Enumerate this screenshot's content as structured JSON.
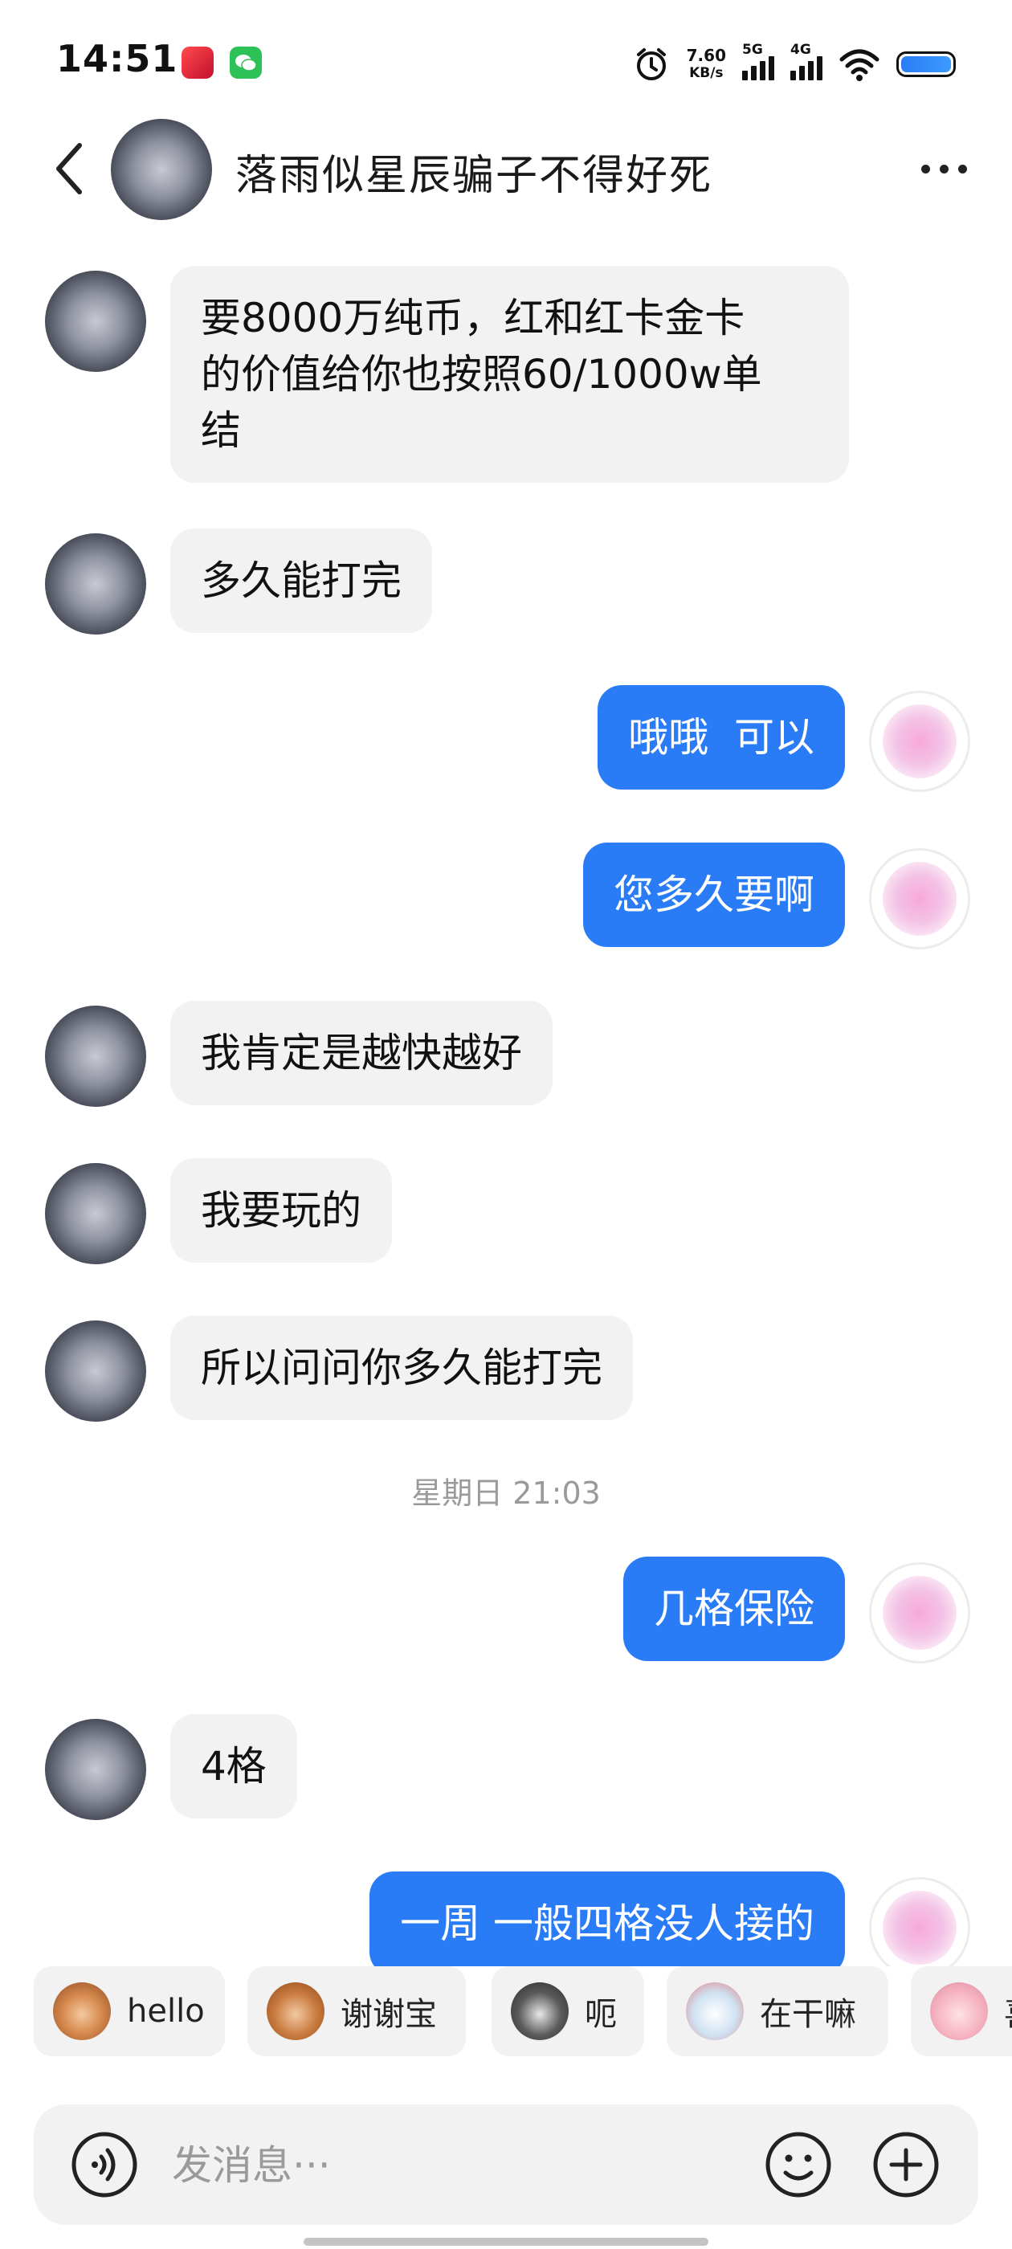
{
  "status_bar": {
    "time": "14:51",
    "net_speed_value": "7.60",
    "net_speed_unit": "KB/s",
    "signal_1_label": "5G",
    "signal_2_label": "4G",
    "battery_level": 1.0
  },
  "header": {
    "title": "落雨似星辰骗子不得好死"
  },
  "messages": [
    {
      "text": "要8000万纯币，红和红卡金卡\n的价值给你也按照60/1000w单\n结"
    },
    {
      "text": "多久能打完"
    },
    {
      "text": "哦哦  可以"
    },
    {
      "text": "您多久要啊"
    },
    {
      "text": "我肯定是越快越好"
    },
    {
      "text": "我要玩的"
    },
    {
      "text": "所以问问你多久能打完"
    },
    {
      "text": "几格保险"
    },
    {
      "text": "4格"
    },
    {
      "text": "一周 一般四格没人接的"
    }
  ],
  "timestamp": "星期日 21:03",
  "quick_replies": [
    {
      "label": "hello",
      "icon": "monkey-emoji-icon"
    },
    {
      "label": "谢谢宝",
      "icon": "thanks-emoji-icon"
    },
    {
      "label": "呃",
      "icon": "cat-emoji-icon"
    },
    {
      "label": "在干嘛",
      "icon": "bear-emoji-icon"
    },
    {
      "label": "喜",
      "icon": "pig-emoji-icon"
    }
  ],
  "input": {
    "placeholder": "发消息···"
  },
  "colors": {
    "outgoing_bubble": "#2a7cf6",
    "incoming_bubble": "#f2f2f2"
  }
}
